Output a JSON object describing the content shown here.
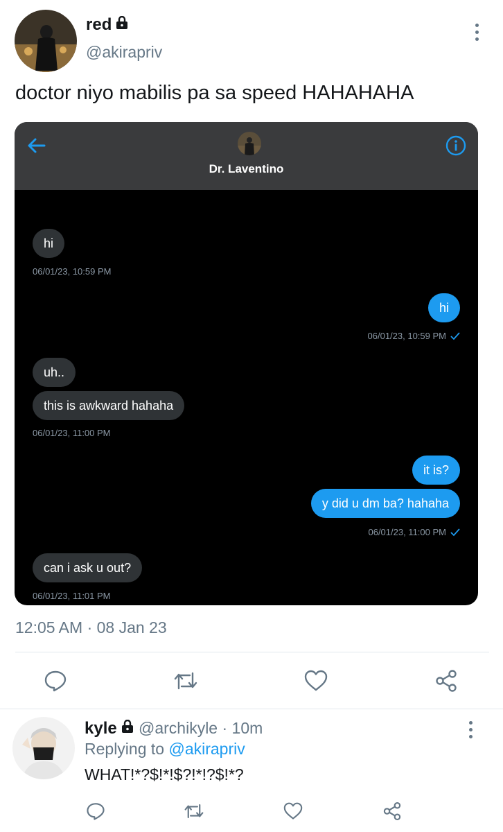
{
  "tweet": {
    "author_name": "red",
    "author_handle": "@akirapriv",
    "text": "doctor niyo mabilis pa sa speed HAHAHAHA",
    "timestamp": "12:05 AM · 08 Jan 23",
    "locked": true
  },
  "dm": {
    "contact_name": "Dr. Laventino",
    "messages": [
      {
        "direction": "in",
        "text": "hi"
      },
      {
        "direction": "meta",
        "text": "06/01/23, 10:59 PM"
      },
      {
        "direction": "out",
        "text": "hi"
      },
      {
        "direction": "meta",
        "text": "06/01/23, 10:59 PM"
      },
      {
        "direction": "in",
        "text": "uh.."
      },
      {
        "direction": "in",
        "text": "this is awkward hahaha"
      },
      {
        "direction": "meta",
        "text": "06/01/23, 11:00 PM"
      },
      {
        "direction": "out",
        "text": "it is?"
      },
      {
        "direction": "out",
        "text": "y did u dm ba? hahaha"
      },
      {
        "direction": "meta",
        "text": "06/01/23, 11:00 PM"
      },
      {
        "direction": "in",
        "text": "can i ask u out?"
      },
      {
        "direction": "meta",
        "text": "06/01/23, 11:01 PM"
      }
    ]
  },
  "reply": {
    "author_name": "kyle",
    "author_handle": "@archikyle",
    "time_ago": "· 10m",
    "replying_prefix": "Replying to",
    "replying_to": "@akirapriv",
    "text": "WHAT!*?$!*!$?!*!?$!*?",
    "locked": true
  },
  "icons": {
    "reply": "reply-icon",
    "retweet": "retweet-icon",
    "like": "like-icon",
    "share": "share-icon",
    "lock": "lock-icon",
    "more": "more-vertical-icon",
    "back": "back-arrow-icon",
    "info": "info-icon"
  },
  "colors": {
    "accent": "#1d9bf0",
    "muted": "#657786",
    "dm_background": "#000000",
    "dm_header": "#3a3b3d",
    "incoming_bubble": "#2f3336"
  }
}
